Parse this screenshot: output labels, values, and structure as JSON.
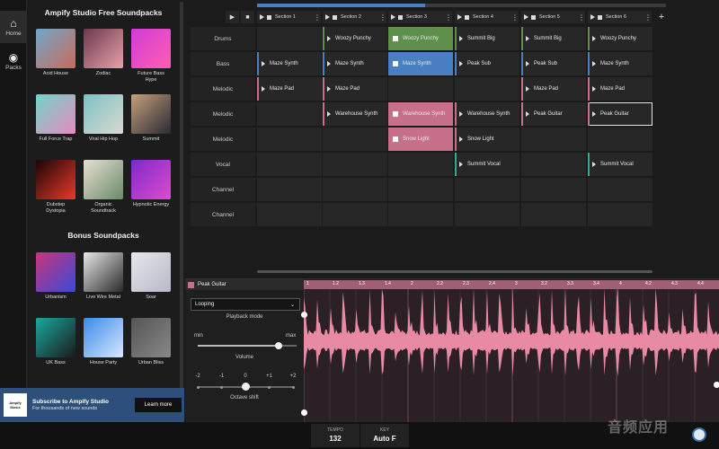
{
  "nav": {
    "home": "Home",
    "packs": "Packs"
  },
  "library": {
    "free_title": "Ampify Studio Free Soundpacks",
    "bonus_title": "Bonus Soundpacks",
    "free_packs": [
      {
        "name": "Acid House",
        "colors": [
          "#6fa9c8",
          "#c96a5a"
        ]
      },
      {
        "name": "Zodiac",
        "colors": [
          "#6b3a4f",
          "#e8a0a8"
        ]
      },
      {
        "name": "Future Bass\nHype",
        "colors": [
          "#d03bd8",
          "#ff5fae"
        ]
      },
      {
        "name": "Full Force Trap",
        "colors": [
          "#6fd4c8",
          "#e88ac0"
        ]
      },
      {
        "name": "Viral Hip Hop",
        "colors": [
          "#7cc1c2",
          "#dad9d2"
        ]
      },
      {
        "name": "Summit",
        "colors": [
          "#c6a07a",
          "#2a2a35"
        ]
      },
      {
        "name": "Dubstep\nDystopia",
        "colors": [
          "#1a0505",
          "#e83a2a"
        ]
      },
      {
        "name": "Organic\nSoundtrack",
        "colors": [
          "#e6e0d2",
          "#6a8a6a"
        ]
      },
      {
        "name": "Hypnotic Energy",
        "colors": [
          "#7a2ac8",
          "#e04ad0"
        ]
      }
    ],
    "bonus_packs": [
      {
        "name": "Urbanism",
        "colors": [
          "#c8357a",
          "#3a4ad8"
        ]
      },
      {
        "name": "Live Wire Metal",
        "colors": [
          "#e8e8e8",
          "#2a2a2a"
        ]
      },
      {
        "name": "Soar",
        "colors": [
          "#e6e6ea",
          "#b8b8c8"
        ]
      },
      {
        "name": "UK Bass",
        "colors": [
          "#1aa8a0",
          "#1a1a1a"
        ]
      },
      {
        "name": "House Party",
        "colors": [
          "#3a8ae8",
          "#d8e8ff"
        ]
      },
      {
        "name": "Urban Bliss",
        "colors": [
          "#555555",
          "#888888"
        ]
      }
    ]
  },
  "subscribe": {
    "logo": "Ampify\nMusic",
    "title": "Subscribe to Ampify Studio",
    "desc": "For thousands of new sounds",
    "button": "Learn more"
  },
  "grid": {
    "progress_fraction": 0.41,
    "sections": [
      "Section 1",
      "Section 2",
      "Section 3",
      "Section 4",
      "Section 5",
      "Section 6"
    ],
    "tracks": [
      "Drums",
      "Bass",
      "Melodic",
      "Melodic",
      "Melodic",
      "Vocal",
      "Channel",
      "Channel"
    ],
    "clips": [
      {
        "row": 0,
        "col": 1,
        "name": "Woozy Punchy",
        "color": "#5e8f4b",
        "state": "idle"
      },
      {
        "row": 0,
        "col": 2,
        "name": "Woozy Punchy",
        "color": "#5e8f4b",
        "state": "playing-green"
      },
      {
        "row": 0,
        "col": 3,
        "name": "Summit Big",
        "color": "#5e8f4b",
        "state": "idle"
      },
      {
        "row": 0,
        "col": 4,
        "name": "Summit Big",
        "color": "#5e8f4b",
        "state": "idle"
      },
      {
        "row": 0,
        "col": 5,
        "name": "Woozy Punchy",
        "color": "#5e8f4b",
        "state": "idle"
      },
      {
        "row": 1,
        "col": 0,
        "name": "Maze Synth",
        "color": "#4a7fc1",
        "state": "idle"
      },
      {
        "row": 1,
        "col": 1,
        "name": "Maze Synth",
        "color": "#4a7fc1",
        "state": "idle"
      },
      {
        "row": 1,
        "col": 2,
        "name": "Maze Synth",
        "color": "#4a7fc1",
        "state": "playing-blue"
      },
      {
        "row": 1,
        "col": 3,
        "name": "Peak Sub",
        "color": "#4a7fc1",
        "state": "idle"
      },
      {
        "row": 1,
        "col": 4,
        "name": "Peak Sub",
        "color": "#4a7fc1",
        "state": "idle"
      },
      {
        "row": 1,
        "col": 5,
        "name": "Maze Synth",
        "color": "#4a7fc1",
        "state": "idle"
      },
      {
        "row": 2,
        "col": 0,
        "name": "Maze Pad",
        "color": "#c77089",
        "state": "idle"
      },
      {
        "row": 2,
        "col": 1,
        "name": "Maze Pad",
        "color": "#c77089",
        "state": "idle"
      },
      {
        "row": 2,
        "col": 4,
        "name": "Maze Pad",
        "color": "#c77089",
        "state": "idle"
      },
      {
        "row": 2,
        "col": 5,
        "name": "Maze Pad",
        "color": "#c77089",
        "state": "idle"
      },
      {
        "row": 3,
        "col": 1,
        "name": "Warehouse Synth",
        "color": "#c77089",
        "state": "idle"
      },
      {
        "row": 3,
        "col": 2,
        "name": "Warehouse Synth",
        "color": "#c77089",
        "state": "playing-pink"
      },
      {
        "row": 3,
        "col": 3,
        "name": "Warehouse Synth",
        "color": "#c77089",
        "state": "idle"
      },
      {
        "row": 3,
        "col": 4,
        "name": "Peak Guitar",
        "color": "#c77089",
        "state": "idle"
      },
      {
        "row": 3,
        "col": 5,
        "name": "Peak Guitar",
        "color": "#c77089",
        "state": "selected"
      },
      {
        "row": 4,
        "col": 2,
        "name": "Snow Light",
        "color": "#c77089",
        "state": "playing-pink"
      },
      {
        "row": 4,
        "col": 3,
        "name": "Snow Light",
        "color": "#c77089",
        "state": "idle"
      },
      {
        "row": 5,
        "col": 3,
        "name": "Summit Vocal",
        "color": "#3aa39a",
        "state": "idle"
      },
      {
        "row": 5,
        "col": 5,
        "name": "Summit Vocal",
        "color": "#3aa39a",
        "state": "idle"
      }
    ]
  },
  "editor": {
    "clip_name": "Peak Guitar",
    "clip_color": "#c77089",
    "playback_mode_value": "Looping",
    "playback_mode_label": "Playback mode",
    "volume_min": "min",
    "volume_max": "max",
    "volume_label": "Volume",
    "volume_fraction": 0.82,
    "octave_label": "Octave shift",
    "octave_ticks": [
      "-2",
      "-1",
      "0",
      "+1",
      "+2"
    ],
    "octave_value": "0",
    "ruler_labels": [
      "1",
      "1.2",
      "1.3",
      "1.4",
      "2",
      "2.2",
      "2.3",
      "2.4",
      "3",
      "3.2",
      "3.3",
      "3.4",
      "4",
      "4.2",
      "4.3",
      "4.4"
    ]
  },
  "footer": {
    "tempo_label": "TEMPO",
    "tempo_value": "132",
    "key_label": "KEY",
    "key_value": "Auto F"
  },
  "watermark": "音频应用"
}
